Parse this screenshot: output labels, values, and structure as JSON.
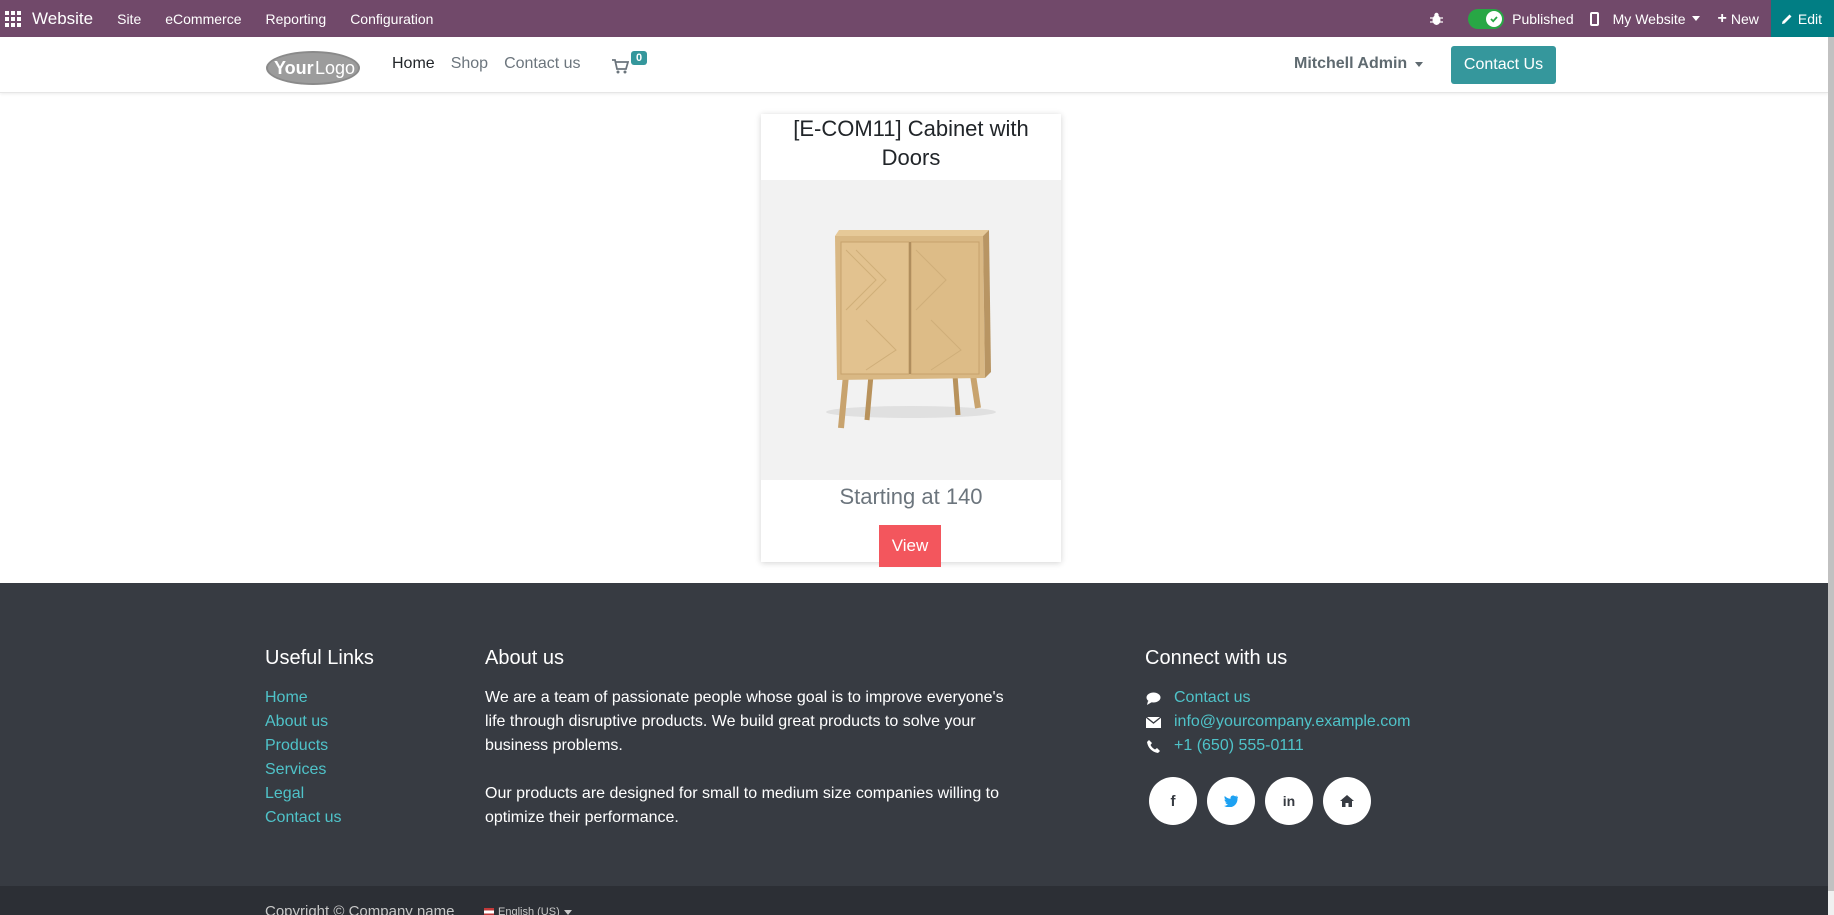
{
  "topbar": {
    "brand": "Website",
    "menu": [
      "Site",
      "eCommerce",
      "Reporting",
      "Configuration"
    ],
    "published_label": "Published",
    "website_label": "My Website",
    "new_label": "New",
    "edit_label": "Edit"
  },
  "header": {
    "logo_text": "YourLogo",
    "nav": [
      "Home",
      "Shop",
      "Contact us"
    ],
    "cart_count": "0",
    "user_name": "Mitchell Admin",
    "contact_button": "Contact Us"
  },
  "product": {
    "title": "[E-COM11] Cabinet with Doors",
    "price": "Starting at 140",
    "view_label": "View"
  },
  "footer": {
    "useful_links_title": "Useful Links",
    "useful_links": [
      "Home",
      "About us",
      "Products",
      "Services",
      "Legal",
      "Contact us"
    ],
    "about_title": "About us",
    "about_p1": "We are a team of passionate people whose goal is to improve everyone's life through disruptive products. We build great products to solve your business problems.",
    "about_p2": "Our products are designed for small to medium size companies willing to optimize their performance.",
    "connect_title": "Connect with us",
    "connect_contact": "Contact us",
    "connect_email": "info@yourcompany.example.com",
    "connect_phone": "+1 (650) 555-0111",
    "socials": [
      "facebook-icon",
      "twitter-icon",
      "linkedin-icon",
      "home-icon"
    ],
    "copyright": "Copyright © Company name",
    "language": "English (US)"
  }
}
